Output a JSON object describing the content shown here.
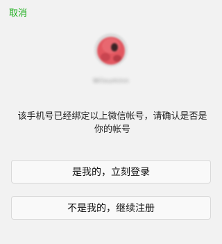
{
  "header": {
    "cancel_label": "取消"
  },
  "account": {
    "avatar_icon": "avatar-icon",
    "username": "Wilxuminn"
  },
  "message": "该手机号已经绑定以上微信帐号，请确认是否是你的帐号",
  "actions": {
    "confirm_label": "是我的，立刻登录",
    "reject_label": "不是我的，继续注册"
  },
  "colors": {
    "accent": "#1aad19",
    "background": "#f2f2f2"
  }
}
